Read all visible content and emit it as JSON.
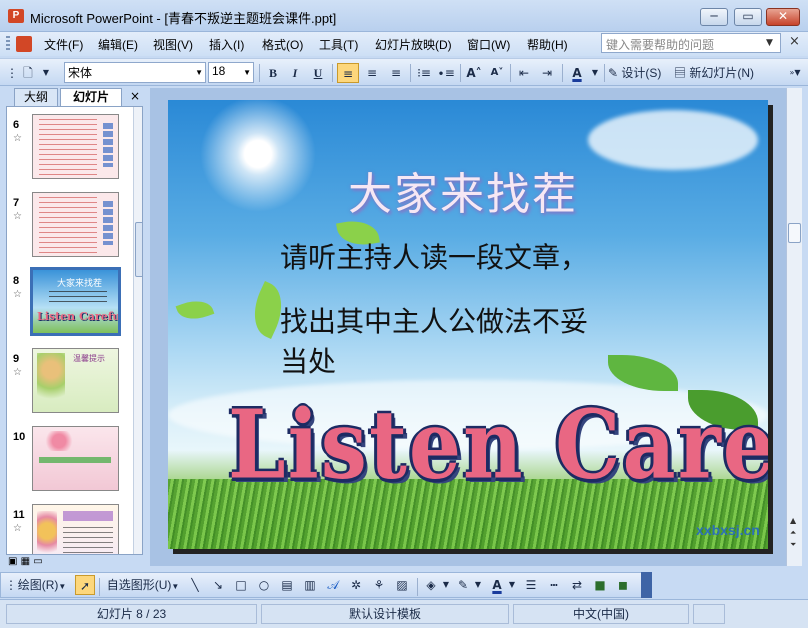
{
  "window": {
    "title": "Microsoft PowerPoint - [青春不叛逆主题班会课件.ppt]",
    "minimize": "─",
    "restore": "▭",
    "close": "✕"
  },
  "menu": {
    "items": [
      "文件(F)",
      "编辑(E)",
      "视图(V)",
      "插入(I)",
      "格式(O)",
      "工具(T)",
      "幻灯片放映(D)",
      "窗口(W)",
      "帮助(H)"
    ],
    "help_placeholder": "键入需要帮助的问题",
    "mdi_close": "×"
  },
  "format_toolbar": {
    "font_name": "宋体",
    "font_size": "18",
    "bold": "B",
    "italic": "I",
    "underline": "U",
    "design_label": "设计(S)",
    "new_slide_label": "新幻灯片(N)",
    "font_color_label": "A"
  },
  "left_pane": {
    "tab_outline": "大纲",
    "tab_slides": "幻灯片",
    "close": "×",
    "slide_numbers": [
      "6",
      "7",
      "8",
      "9",
      "10",
      "11"
    ],
    "selected_slide": "8"
  },
  "slide": {
    "title": "大家来找茬",
    "body_line1": "请听主持人读一段文章，",
    "body_line2": "找出其中主人公做法不妥",
    "body_line3": "当处",
    "wordart": "Listen  Carefully",
    "watermark": "xxbxsj.cn"
  },
  "thumbs": {
    "t8_title": "大家来找茬",
    "t8_wordart": "Listen  Carefully",
    "t9_title": "温馨提示"
  },
  "draw_toolbar": {
    "draw_label": "绘图(R)",
    "autoshapes_label": "自选图形(U)"
  },
  "status": {
    "slide_info": "幻灯片 8 / 23",
    "template": "默认设计模板",
    "language": "中文(中国)"
  }
}
